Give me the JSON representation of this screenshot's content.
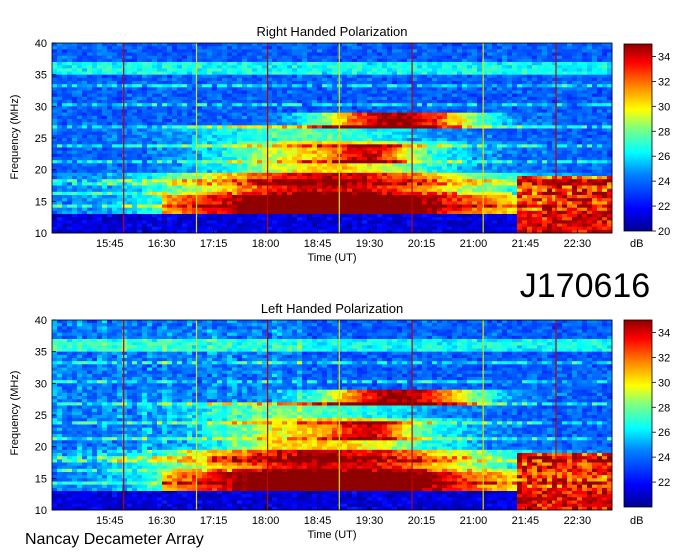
{
  "chart_data": [
    {
      "type": "heatmap",
      "title": "Right Handed Polarization",
      "xlabel": "Time (UT)",
      "ylabel": "Frequency (MHz)",
      "x_ticks": [
        "15:45",
        "16:30",
        "17:15",
        "18:00",
        "18:45",
        "19:30",
        "20:15",
        "21:00",
        "21:45",
        "22:30"
      ],
      "y_ticks": [
        "10",
        "15",
        "20",
        "25",
        "30",
        "35",
        "40"
      ],
      "xlim": [
        "14:55",
        "23:00"
      ],
      "ylim": [
        10,
        40
      ],
      "colorbar": {
        "label": "dB",
        "ticks": [
          "20",
          "22",
          "24",
          "26",
          "28",
          "30",
          "32",
          "34"
        ],
        "range": [
          20,
          35
        ]
      },
      "colormap": [
        "#00008f",
        "#0000ff",
        "#0080ff",
        "#00ffff",
        "#80ff80",
        "#ffff00",
        "#ff8000",
        "#ff0000",
        "#8f0000"
      ]
    },
    {
      "type": "heatmap",
      "title": "Left Handed Polarization",
      "xlabel": "Time (UT)",
      "ylabel": "Frequency (MHz)",
      "x_ticks": [
        "15:45",
        "16:30",
        "17:15",
        "18:00",
        "18:45",
        "19:30",
        "20:15",
        "21:00",
        "21:45",
        "22:30"
      ],
      "y_ticks": [
        "10",
        "15",
        "20",
        "25",
        "30",
        "35",
        "40"
      ],
      "xlim": [
        "14:55",
        "23:00"
      ],
      "ylim": [
        10,
        40
      ],
      "colorbar": {
        "label": "dB",
        "ticks": [
          "22",
          "24",
          "26",
          "28",
          "30",
          "32",
          "34"
        ],
        "range": [
          20,
          35
        ]
      },
      "colormap": [
        "#00008f",
        "#0000ff",
        "#0080ff",
        "#00ffff",
        "#80ff80",
        "#ffff00",
        "#ff8000",
        "#ff0000",
        "#8f0000"
      ]
    }
  ],
  "event_id": "J170616",
  "footer": "Nancay Decameter Array"
}
